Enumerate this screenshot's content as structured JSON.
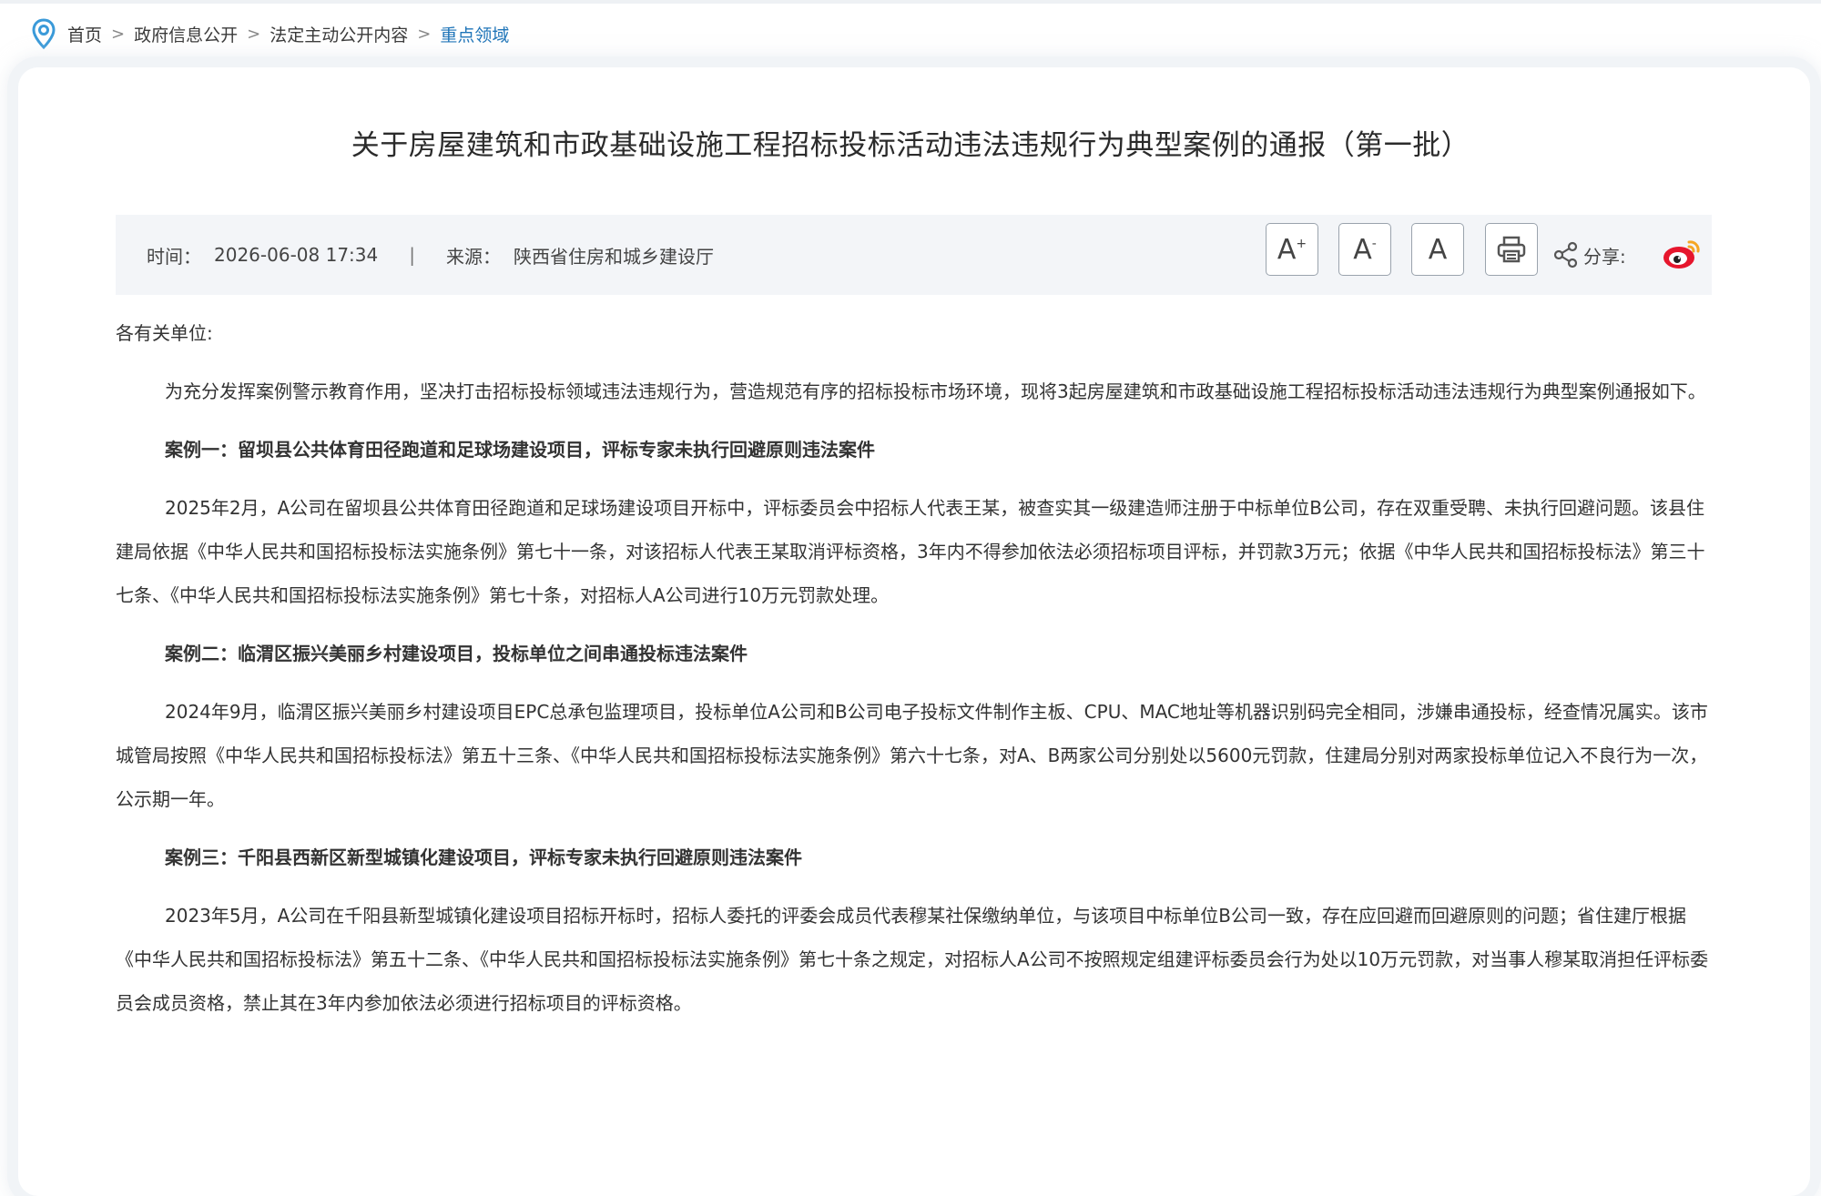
{
  "breadcrumb": {
    "items": [
      "首页",
      "政府信息公开",
      "法定主动公开内容",
      "重点领域"
    ],
    "separator": ">"
  },
  "article": {
    "title": "关于房屋建筑和市政基础设施工程招标投标活动违法违规行为典型案例的通报（第一批）",
    "time_label": "时间：",
    "time_value": "2026-06-08 17:34",
    "divider": "|",
    "source_label": "来源：",
    "source_value": "陕西省住房和城乡建设厅"
  },
  "toolbar": {
    "font_increase": "A",
    "font_increase_mark": "+",
    "font_decrease": "A",
    "font_decrease_mark": "-",
    "font_reset": "A",
    "share_label": "分享:"
  },
  "body": {
    "salutation": "各有关单位:",
    "intro": "为充分发挥案例警示教育作用，坚决打击招标投标领域违法违规行为，营造规范有序的招标投标市场环境，现将3起房屋建筑和市政基础设施工程招标投标活动违法违规行为典型案例通报如下。",
    "cases": [
      {
        "title": "案例一：留坝县公共体育田径跑道和足球场建设项目，评标专家未执行回避原则违法案件",
        "text": "2025年2月，A公司在留坝县公共体育田径跑道和足球场建设项目开标中，评标委员会中招标人代表王某，被查实其一级建造师注册于中标单位B公司，存在双重受聘、未执行回避问题。该县住建局依据《中华人民共和国招标投标法实施条例》第七十一条，对该招标人代表王某取消评标资格，3年内不得参加依法必须招标项目评标，并罚款3万元；依据《中华人民共和国招标投标法》第三十七条、《中华人民共和国招标投标法实施条例》第七十条，对招标人A公司进行10万元罚款处理。"
      },
      {
        "title": "案例二：临渭区振兴美丽乡村建设项目，投标单位之间串通投标违法案件",
        "text": "2024年9月，临渭区振兴美丽乡村建设项目EPC总承包监理项目，投标单位A公司和B公司电子投标文件制作主板、CPU、MAC地址等机器识别码完全相同，涉嫌串通投标，经查情况属实。该市城管局按照《中华人民共和国招标投标法》第五十三条、《中华人民共和国招标投标法实施条例》第六十七条，对A、B两家公司分别处以5600元罚款，住建局分别对两家投标单位记入不良行为一次，公示期一年。"
      },
      {
        "title": "案例三：千阳县西新区新型城镇化建设项目，评标专家未执行回避原则违法案件",
        "text": "2023年5月，A公司在千阳县新型城镇化建设项目招标开标时，招标人委托的评委会成员代表穆某社保缴纳单位，与该项目中标单位B公司一致，存在应回避而回避原则的问题；省住建厅根据《中华人民共和国招标投标法》第五十二条、《中华人民共和国招标投标法实施条例》第七十条之规定，对招标人A公司不按照规定组建评标委员会行为处以10万元罚款，对当事人穆某取消担任评标委员会成员资格，禁止其在3年内参加依法必须进行招标项目的评标资格。"
      }
    ]
  },
  "colors": {
    "link_active": "#1e74b8",
    "meta_bg": "#f3f5f8",
    "weibo_red": "#e6162d",
    "weibo_orange": "#f5a623",
    "location_icon": "#3a9ad9"
  },
  "icons": [
    "location-pin-icon",
    "print-icon",
    "share-icon",
    "weibo-icon"
  ]
}
